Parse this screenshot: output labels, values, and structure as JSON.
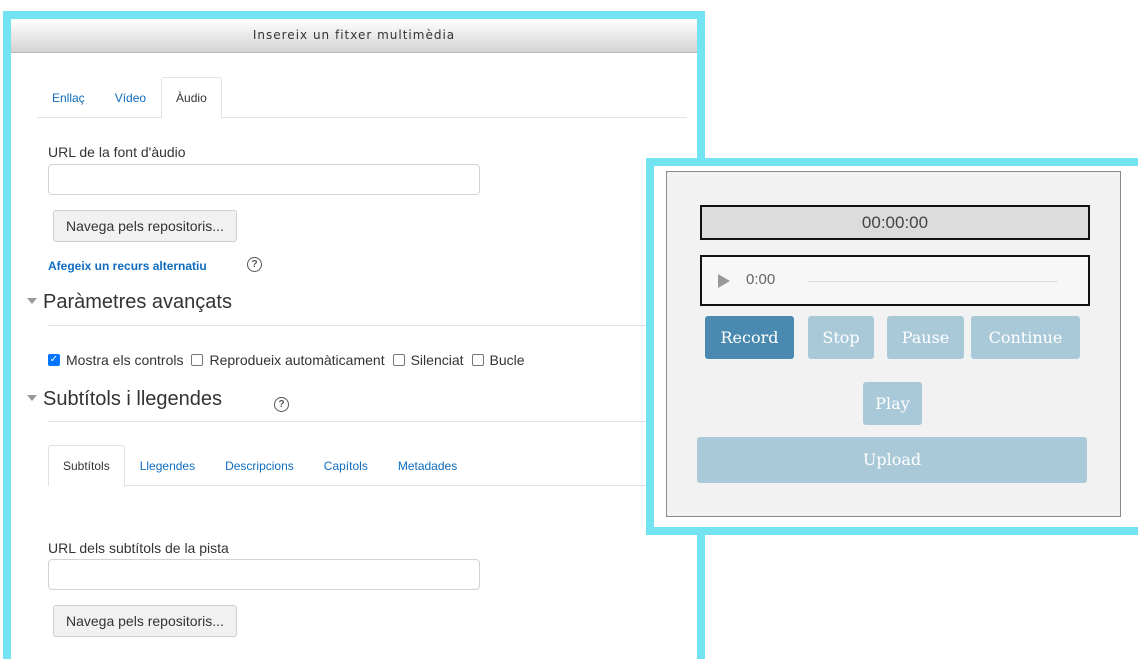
{
  "dialog": {
    "title": "Insereix un fitxer multimèdia",
    "tabs": [
      {
        "label": "Enllaç",
        "active": false
      },
      {
        "label": "Vídeo",
        "active": false
      },
      {
        "label": "Àudio",
        "active": true
      }
    ],
    "source_url_label": "URL de la font d'àudio",
    "source_url_value": "",
    "browse_label": "Navega pels repositoris...",
    "add_alternative_label": "Afegeix un recurs alternatiu",
    "advanced": {
      "title": "Paràmetres avançats",
      "options": [
        {
          "label": "Mostra els controls",
          "checked": true
        },
        {
          "label": "Reprodueix automàticament",
          "checked": false
        },
        {
          "label": "Silenciat",
          "checked": false
        },
        {
          "label": "Bucle",
          "checked": false
        }
      ]
    },
    "subtitles": {
      "title": "Subtítols i llegendes",
      "tabs": [
        {
          "label": "Subtítols",
          "active": true
        },
        {
          "label": "Llegendes",
          "active": false
        },
        {
          "label": "Descripcions",
          "active": false
        },
        {
          "label": "Capítols",
          "active": false
        },
        {
          "label": "Metadades",
          "active": false
        }
      ],
      "track_url_label": "URL dels subtítols de la pista",
      "track_url_value": "",
      "browse_label": "Navega pels repositoris..."
    },
    "help_icon": "question-circle-icon"
  },
  "recorder": {
    "timer": "00:00:00",
    "player_time": "0:00",
    "buttons": {
      "record": "Record",
      "stop": "Stop",
      "pause": "Pause",
      "continue": "Continue",
      "play": "Play",
      "upload": "Upload"
    }
  },
  "colors": {
    "highlight_border": "#73e3f2",
    "link": "#0f6cbf",
    "record_button": "#4a8ab0",
    "disabled_button": "#a9c9d9"
  }
}
